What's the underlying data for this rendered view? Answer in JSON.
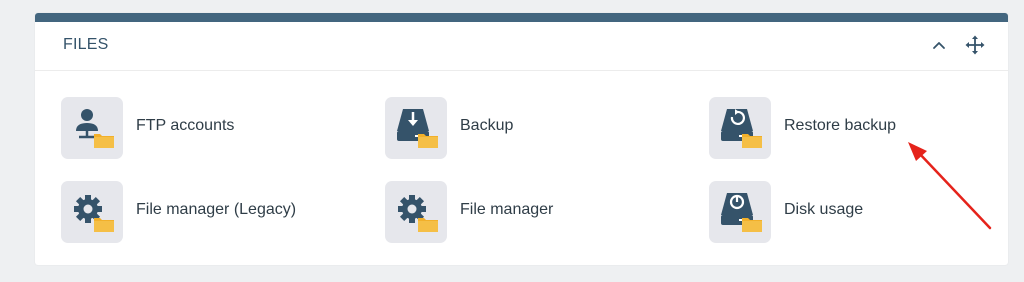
{
  "panel": {
    "title": "FILES",
    "header_color": "#43667f",
    "collapse_icon": "chevron-up-icon",
    "move_icon": "move-arrows-icon"
  },
  "items": [
    {
      "label": "FTP accounts",
      "icon": "ftp-user-folder-icon"
    },
    {
      "label": "Backup",
      "icon": "backup-drive-folder-icon"
    },
    {
      "label": "Restore backup",
      "icon": "restore-drive-folder-icon"
    },
    {
      "label": "File manager (Legacy)",
      "icon": "gear-folder-icon"
    },
    {
      "label": "File manager",
      "icon": "gear-folder-icon"
    },
    {
      "label": "Disk usage",
      "icon": "disk-usage-folder-icon"
    }
  ],
  "colors": {
    "icon_dark": "#35536a",
    "folder_yellow": "#f2b02a",
    "annotation_red": "#e5231b"
  }
}
